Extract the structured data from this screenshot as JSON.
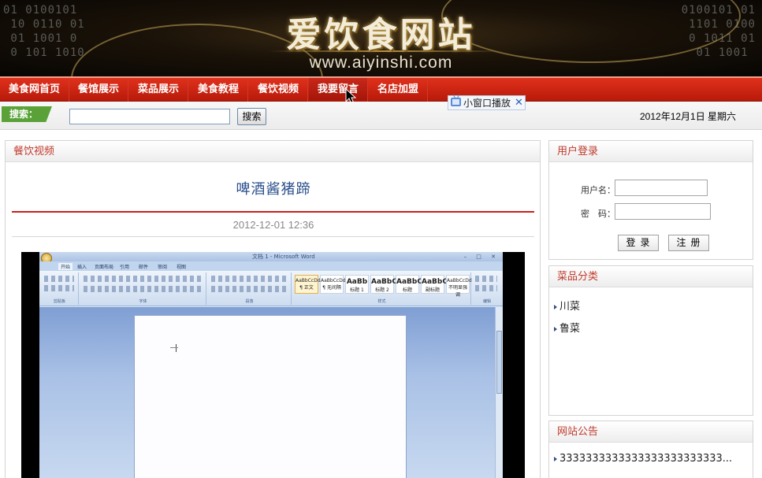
{
  "banner": {
    "title": "爱饮食网站",
    "url": "www.aiyinshi.com",
    "binary_left": "01 0100101\n 10 0110 01\n 01 1001 0\n 0 101 1010",
    "binary_right": "0100101 01\n 1101 0100\n 0 1011 01\n  01 1001"
  },
  "nav": {
    "items": [
      {
        "label": "美食网首页"
      },
      {
        "label": "餐馆展示"
      },
      {
        "label": "菜品展示"
      },
      {
        "label": "美食教程"
      },
      {
        "label": "餐饮视频"
      },
      {
        "label": "我要留言"
      },
      {
        "label": "名店加盟"
      }
    ],
    "colors": {
      "bar": "#c8240f",
      "text": "#ffffff"
    }
  },
  "search": {
    "tag": "搜索：",
    "input_value": "",
    "button": "搜索"
  },
  "date_text": "2012年12月1日 星期六",
  "popup": {
    "label": "小窗口播放",
    "icon": "tv-icon",
    "close": "✕"
  },
  "main": {
    "section_title": "餐饮视频",
    "article_title": "啤酒酱猪蹄",
    "article_date": "2012-12-01 12:36",
    "video": {
      "window_title": "文档 1 - Microsoft Word",
      "tabs": [
        "开始",
        "插入",
        "页面布局",
        "引用",
        "邮件",
        "审阅",
        "视图"
      ],
      "styles": [
        {
          "sample": "AaBbCcDd",
          "name": "¶ 正文"
        },
        {
          "sample": "AaBbCcDd",
          "name": "¶ 无间隔"
        },
        {
          "sample": "AaBb",
          "name": "标题 1"
        },
        {
          "sample": "AaBbC",
          "name": "标题 2"
        },
        {
          "sample": "AaBbC",
          "name": "标题"
        },
        {
          "sample": "AaBbC",
          "name": "副标题"
        },
        {
          "sample": "AaBbCcDd",
          "name": "不明显强调"
        }
      ],
      "group_labels": [
        "剪贴板",
        "字体",
        "段落",
        "样式",
        "编辑"
      ]
    }
  },
  "login": {
    "title": "用户登录",
    "username_label": "用户名：",
    "password_label": "密　码：",
    "login_button": "登录",
    "register_button": "注册"
  },
  "categories": {
    "title": "菜品分类",
    "items": [
      "川菜",
      "鲁菜"
    ]
  },
  "notice": {
    "title": "网站公告",
    "items": [
      "3333333333333333333333333..."
    ]
  }
}
